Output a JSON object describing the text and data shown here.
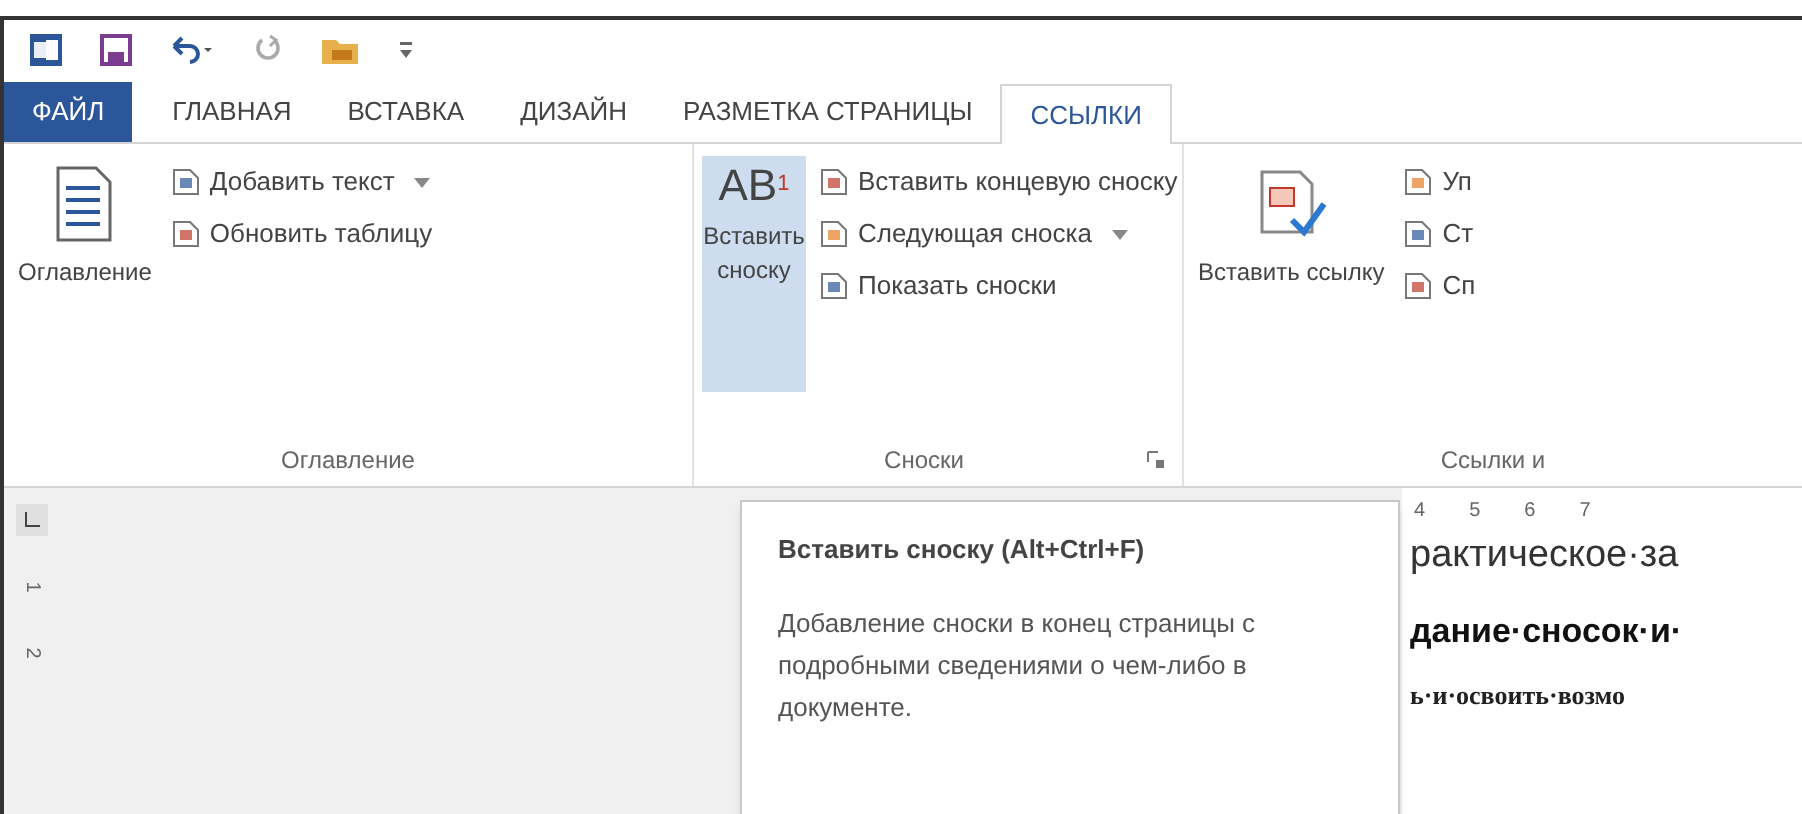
{
  "tabs": [
    {
      "label": "ФАЙЛ",
      "kind": "file",
      "selected": false
    },
    {
      "label": "ГЛАВНАЯ",
      "kind": "tab",
      "selected": false
    },
    {
      "label": "ВСТАВКА",
      "kind": "tab",
      "selected": false
    },
    {
      "label": "ДИЗАЙН",
      "kind": "tab",
      "selected": false
    },
    {
      "label": "РАЗМЕТКА СТРАНИЦЫ",
      "kind": "tab",
      "selected": false
    },
    {
      "label": "ССЫЛКИ",
      "kind": "tab",
      "selected": true
    }
  ],
  "groups": [
    {
      "label": "Оглавление",
      "large": {
        "label": "Оглавление",
        "selected": false
      },
      "small": [
        {
          "label": "Добавить текст",
          "dropdown": true
        },
        {
          "label": "Обновить таблицу",
          "dropdown": false
        }
      ],
      "launcher": false
    },
    {
      "label": "Сноски",
      "large": {
        "label": "Вставить сноску",
        "selected": true,
        "icon_text": "AB",
        "icon_superscript": "1"
      },
      "small": [
        {
          "label": "Вставить концевую сноску",
          "dropdown": false
        },
        {
          "label": "Следующая сноска",
          "dropdown": true
        },
        {
          "label": "Показать сноски",
          "dropdown": false
        }
      ],
      "launcher": true
    },
    {
      "label": "Ссылки и",
      "large": {
        "label": "Вставить ссылку",
        "selected": false
      },
      "small": [
        {
          "label": "Уп",
          "dropdown": false
        },
        {
          "label": "Ст",
          "dropdown": false
        },
        {
          "label": "Сп",
          "dropdown": false
        }
      ],
      "launcher": false
    }
  ],
  "ruler": [
    "4",
    "5",
    "6",
    "7"
  ],
  "vertical_ruler": [
    "1",
    "2"
  ],
  "tooltip": {
    "title": "Вставить сноску (Alt+Ctrl+F)",
    "description": "Добавление сноски в конец страницы с подробными сведениями о чем-либо в документе."
  },
  "document": [
    {
      "text": "рактическое·за",
      "kind": "heading"
    },
    {
      "text": "дание·сносок·и·",
      "kind": "subheading"
    },
    {
      "text": "ь·и·освоить·возмо",
      "kind": "body"
    }
  ]
}
